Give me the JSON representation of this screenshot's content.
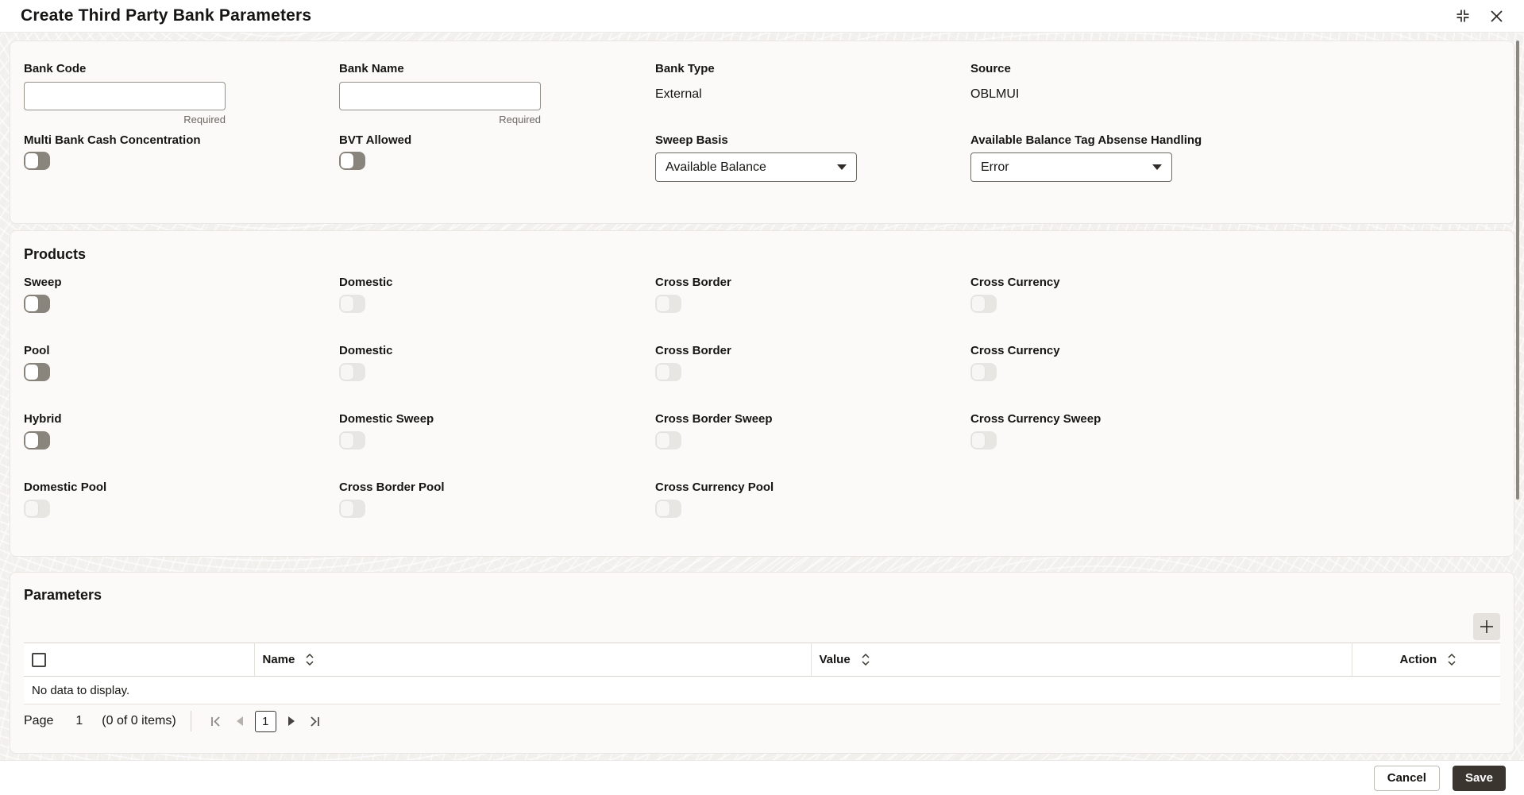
{
  "window": {
    "title": "Create Third Party Bank Parameters"
  },
  "icons": {
    "restore": "restore-window-corner-brackets",
    "close": "x-mark",
    "dropdown": "caret-down-triangle",
    "sort": "up-down-chevrons",
    "add": "plus",
    "page_first": "bar-chevron-left",
    "page_prev": "triangle-left",
    "page_next": "triangle-right",
    "page_last": "chevron-right-bar"
  },
  "form": {
    "bank_code": {
      "label": "Bank Code",
      "value": "",
      "required_hint": "Required"
    },
    "bank_name": {
      "label": "Bank Name",
      "value": "",
      "required_hint": "Required"
    },
    "bank_type": {
      "label": "Bank Type",
      "value": "External"
    },
    "source": {
      "label": "Source",
      "value": "OBLMUI"
    },
    "multi_bank_cash_concentration": {
      "label": "Multi Bank Cash Concentration",
      "state": "off"
    },
    "bvt_allowed": {
      "label": "BVT Allowed",
      "state": "off"
    },
    "sweep_basis": {
      "label": "Sweep Basis",
      "value": "Available Balance"
    },
    "abs_handling": {
      "label": "Available Balance Tag Absense Handling",
      "value": "Error"
    }
  },
  "products": {
    "title": "Products",
    "rows": [
      {
        "cells": [
          {
            "label": "Sweep",
            "state": "off",
            "disabled": false
          },
          {
            "label": "Domestic",
            "state": "off",
            "disabled": true
          },
          {
            "label": "Cross Border",
            "state": "off",
            "disabled": true
          },
          {
            "label": "Cross Currency",
            "state": "off",
            "disabled": true
          }
        ]
      },
      {
        "cells": [
          {
            "label": "Pool",
            "state": "off",
            "disabled": false
          },
          {
            "label": "Domestic",
            "state": "off",
            "disabled": true
          },
          {
            "label": "Cross Border",
            "state": "off",
            "disabled": true
          },
          {
            "label": "Cross Currency",
            "state": "off",
            "disabled": true
          }
        ]
      },
      {
        "cells": [
          {
            "label": "Hybrid",
            "state": "off",
            "disabled": false
          },
          {
            "label": "Domestic Sweep",
            "state": "off",
            "disabled": true
          },
          {
            "label": "Cross Border Sweep",
            "state": "off",
            "disabled": true
          },
          {
            "label": "Cross Currency Sweep",
            "state": "off",
            "disabled": true
          }
        ]
      },
      {
        "cells": [
          {
            "label": "Domestic Pool",
            "state": "off",
            "disabled": true
          },
          {
            "label": "Cross Border Pool",
            "state": "off",
            "disabled": true
          },
          {
            "label": "Cross Currency Pool",
            "state": "off",
            "disabled": true
          }
        ]
      }
    ]
  },
  "parameters": {
    "title": "Parameters",
    "columns": {
      "name": "Name",
      "value": "Value",
      "action": "Action"
    },
    "empty_text": "No data to display.",
    "pagination": {
      "page_label": "Page",
      "page_number": "1",
      "items_text": "(0 of 0 items)",
      "current_page": "1"
    }
  },
  "footer": {
    "cancel": "Cancel",
    "save": "Save"
  },
  "colors": {
    "save_button_bg": "#3a352f",
    "toggle_on_track": "#8a857c",
    "toggle_disabled_track": "#e8e6e2",
    "card_bg": "#fbfaf8",
    "pattern_bg": "#f2f0ed",
    "text": "#161513"
  }
}
